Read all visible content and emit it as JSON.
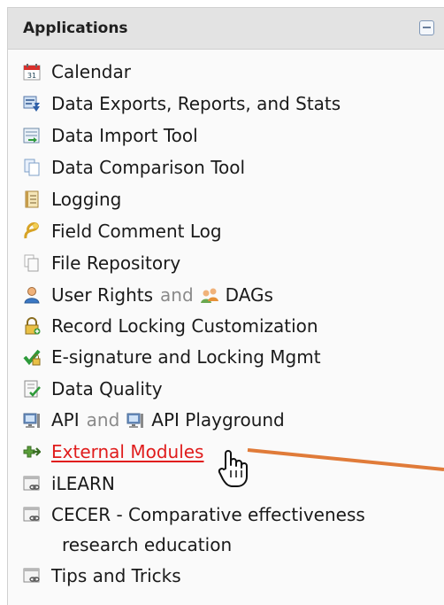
{
  "panel": {
    "title": "Applications",
    "collapse_icon": "minus-square-icon"
  },
  "items": [
    {
      "label": "Calendar",
      "icon": "calendar-icon"
    },
    {
      "label": "Data Exports, Reports, and Stats",
      "icon": "export-icon"
    },
    {
      "label": "Data Import Tool",
      "icon": "import-icon"
    },
    {
      "label": "Data Comparison Tool",
      "icon": "compare-icon"
    },
    {
      "label": "Logging",
      "icon": "log-icon"
    },
    {
      "label": "Field Comment Log",
      "icon": "comment-icon"
    },
    {
      "label": "File Repository",
      "icon": "files-icon"
    },
    {
      "label": "User Rights",
      "icon": "user-icon",
      "joiner": "and",
      "second_label": "DAGs",
      "second_icon": "group-icon"
    },
    {
      "label": "Record Locking Customization",
      "icon": "lock-icon"
    },
    {
      "label": "E-signature and Locking Mgmt",
      "icon": "esign-icon"
    },
    {
      "label": "Data Quality",
      "icon": "checklist-icon"
    },
    {
      "label": "API",
      "icon": "computer-icon",
      "joiner": "and",
      "second_label": "API Playground",
      "second_icon": "computer-icon"
    },
    {
      "label": "External Modules",
      "icon": "puzzle-icon"
    },
    {
      "label": "iLEARN",
      "icon": "link-window-icon"
    },
    {
      "label": "CECER - Comparative effectiveness",
      "label_cont": "research education",
      "icon": "link-window-icon"
    },
    {
      "label": "Tips and Tricks",
      "icon": "link-window-icon"
    }
  ],
  "colors": {
    "header_bg": "#e3e3e3",
    "link_active": "#e01c1c",
    "annotation_arrow": "#e07b39"
  }
}
